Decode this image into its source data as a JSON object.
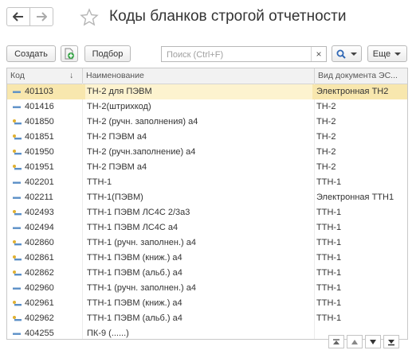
{
  "window": {
    "title": "Коды бланков строгой отчетности"
  },
  "toolbar": {
    "create_label": "Создать",
    "select_label": "Подбор",
    "more_label": "Еще",
    "search_placeholder": "Поиск (Ctrl+F)",
    "search_value": "",
    "clear_symbol": "×"
  },
  "table": {
    "columns": [
      "Код",
      "Наименование",
      "Вид документа ЭС..."
    ],
    "sort_indicator": "↓",
    "rows": [
      {
        "code": "401103",
        "name": "ТН-2  для ПЭВМ",
        "doctype": "Электронная ТН2",
        "icon": "dash-icon",
        "selected": true
      },
      {
        "code": "401416",
        "name": "ТН-2(штрихкод)",
        "doctype": "ТН-2",
        "icon": "dash-icon",
        "selected": false
      },
      {
        "code": "401850",
        "name": "ТН-2 (ручн. заполнения) а4",
        "doctype": "ТН-2",
        "icon": "dash-dot-icon",
        "selected": false
      },
      {
        "code": "401851",
        "name": "ТН-2 ПЭВМ а4",
        "doctype": "ТН-2",
        "icon": "dash-dot-icon",
        "selected": false
      },
      {
        "code": "401950",
        "name": "ТН-2 (ручн.заполнение) а4",
        "doctype": "ТН-2",
        "icon": "dash-dot-icon",
        "selected": false
      },
      {
        "code": "401951",
        "name": "ТН-2 ПЭВМ а4",
        "doctype": "ТН-2",
        "icon": "dash-dot-icon",
        "selected": false
      },
      {
        "code": "402201",
        "name": "ТТН-1",
        "doctype": "ТТН-1",
        "icon": "dash-icon",
        "selected": false
      },
      {
        "code": "402211",
        "name": "ТТН-1(ПЭВМ)",
        "doctype": "Электронная ТТН1",
        "icon": "dash-icon",
        "selected": false
      },
      {
        "code": "402493",
        "name": "ТТН-1 ПЭВМ ЛС4С 2/3а3",
        "doctype": "ТТН-1",
        "icon": "dash-dot-icon",
        "selected": false
      },
      {
        "code": "402494",
        "name": "ТТН-1 ПЭВМ ЛС4С а4",
        "doctype": "ТТН-1",
        "icon": "dash-icon",
        "selected": false
      },
      {
        "code": "402860",
        "name": "ТТН-1 (ручн. заполнен.) а4",
        "doctype": "ТТН-1",
        "icon": "dash-dot-icon",
        "selected": false
      },
      {
        "code": "402861",
        "name": "ТТН-1 ПЭВМ (книж.) а4",
        "doctype": "ТТН-1",
        "icon": "dash-dot-icon",
        "selected": false
      },
      {
        "code": "402862",
        "name": "ТТН-1 ПЭВМ (альб.) а4",
        "doctype": "ТТН-1",
        "icon": "dash-dot-icon",
        "selected": false
      },
      {
        "code": "402960",
        "name": "ТТН-1 (ручн. заполнен.) а4",
        "doctype": "ТТН-1",
        "icon": "dash-icon",
        "selected": false
      },
      {
        "code": "402961",
        "name": "ТТН-1 ПЭВМ (книж.) а4",
        "doctype": "ТТН-1",
        "icon": "dash-dot-icon",
        "selected": false
      },
      {
        "code": "402962",
        "name": "ТТН-1 ПЭВМ (альб.) а4",
        "doctype": "ТТН-1",
        "icon": "dash-dot-icon",
        "selected": false
      },
      {
        "code": "404255",
        "name": "ПК-9 (......)",
        "doctype": "",
        "icon": "dash-icon",
        "selected": false
      }
    ]
  },
  "colors": {
    "selection": "#f8e7ae",
    "accent_green": "#3aa64a",
    "icon_blue": "#5b8fc7",
    "icon_yellow": "#e0b030"
  }
}
